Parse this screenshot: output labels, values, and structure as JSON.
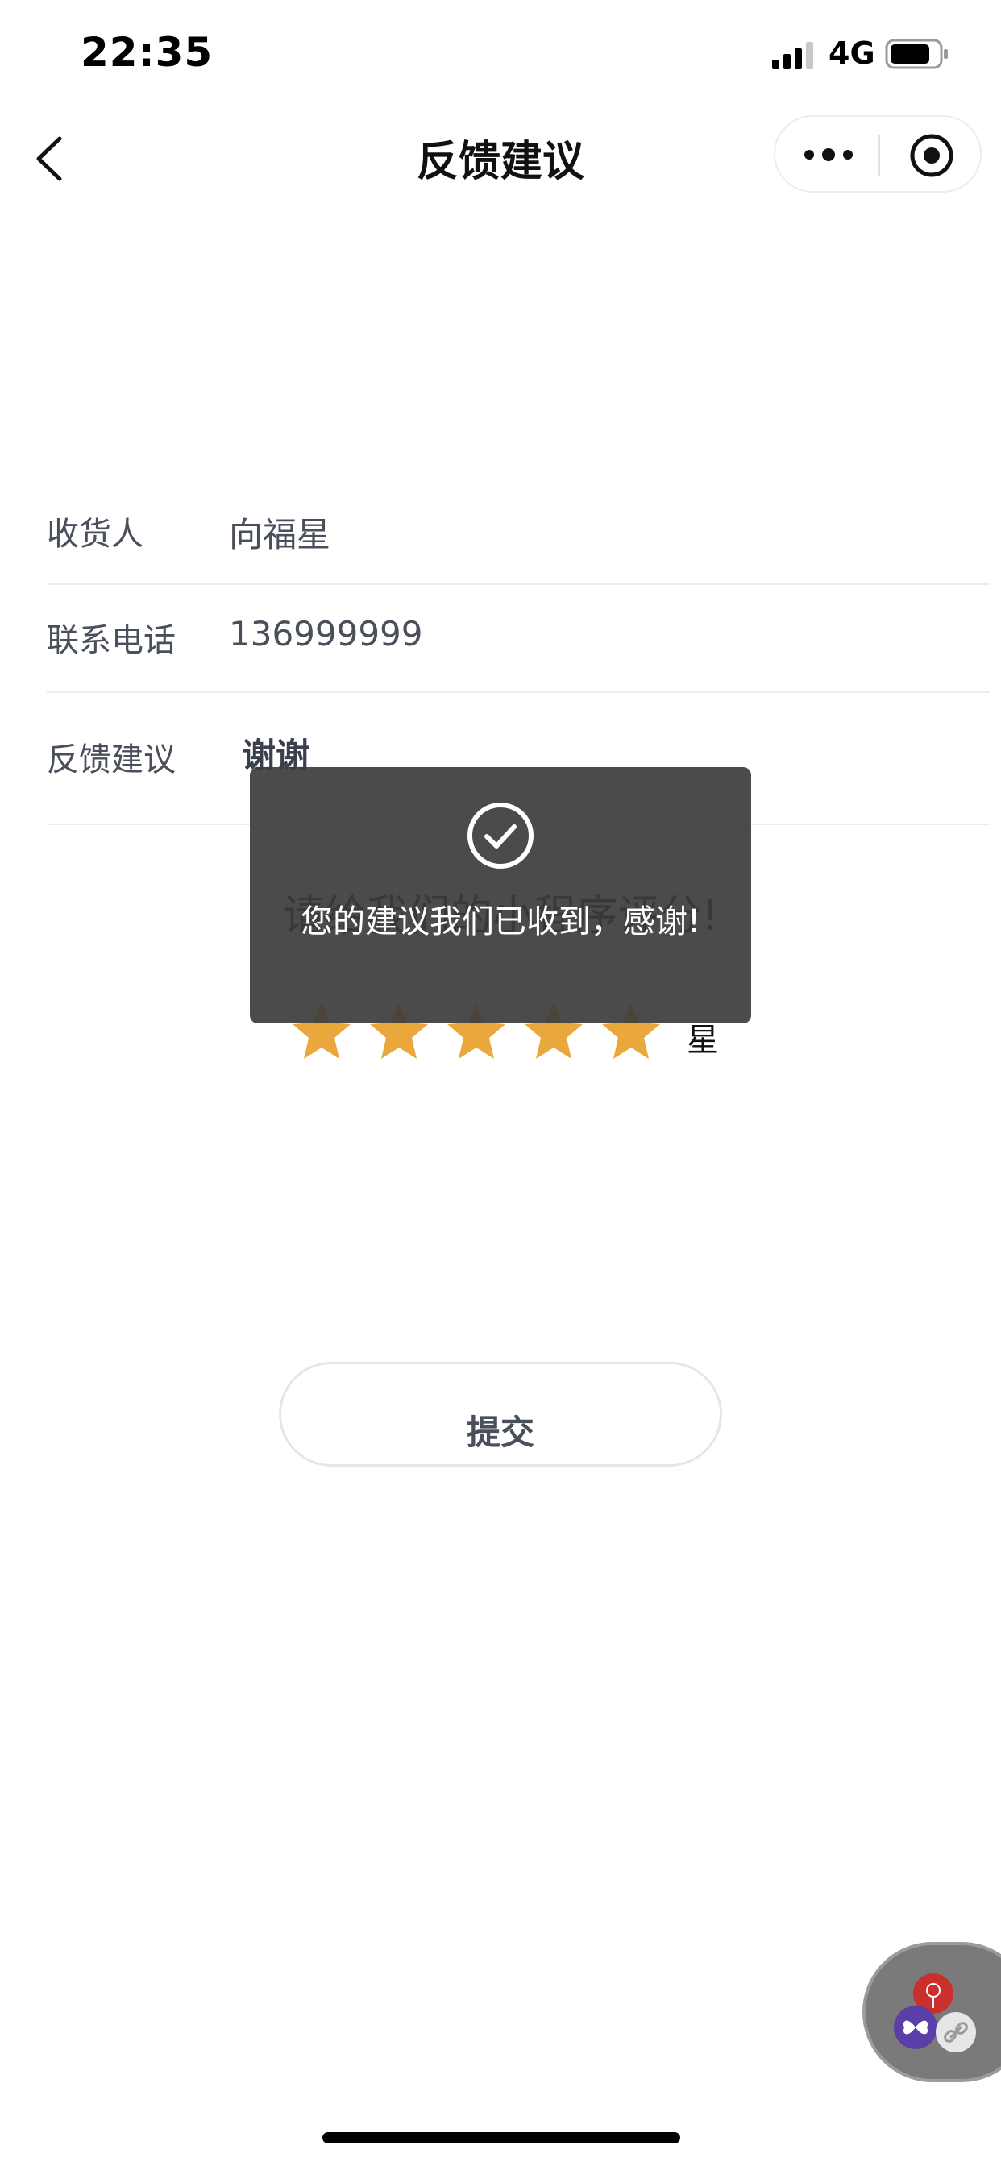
{
  "status_bar": {
    "time": "22:35",
    "network": "4G"
  },
  "nav": {
    "title": "反馈建议"
  },
  "form": {
    "recipient_label": "收货人",
    "recipient_value": "向福星",
    "phone_label": "联系电话",
    "phone_value": "136999999",
    "feedback_label": "反馈建议",
    "feedback_value": "谢谢"
  },
  "rating": {
    "prompt": "请给我们的小程序评分!",
    "stars": 5,
    "max_stars": 5,
    "unit": "星",
    "star_color": "#EAA73C"
  },
  "submit": {
    "label": "提交"
  },
  "toast": {
    "message": "您的建议我们已收到，感谢!"
  },
  "icons": {
    "back": "back-chevron-icon",
    "more": "more-dots-icon",
    "close": "target-circle-icon",
    "check": "check-circle-icon"
  }
}
